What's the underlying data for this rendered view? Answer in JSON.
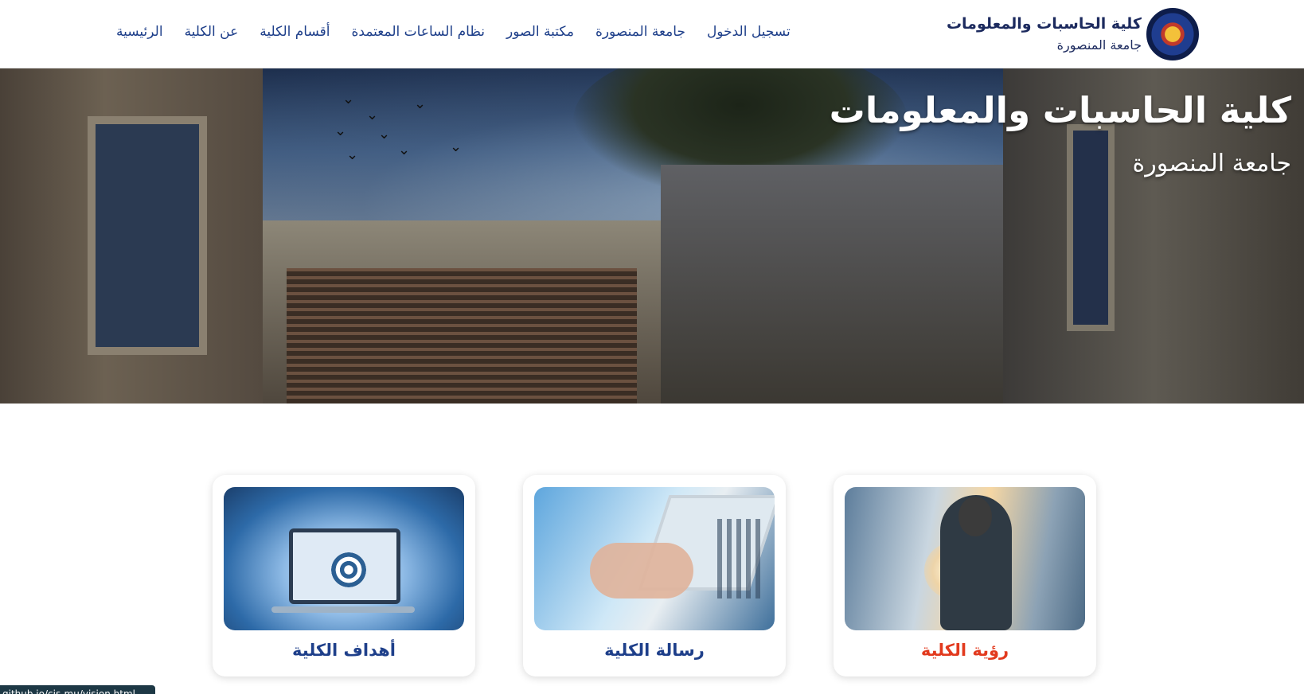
{
  "brand": {
    "title": "كلية الحاسبات والمعلومات",
    "subtitle": "جامعة المنصورة"
  },
  "nav": {
    "items": [
      {
        "label": "الرئيسية"
      },
      {
        "label": "عن الكلية"
      },
      {
        "label": "أقسام الكلية"
      },
      {
        "label": "نظام الساعات المعتمدة"
      },
      {
        "label": "مكتبة الصور"
      },
      {
        "label": "جامعة المنصورة"
      },
      {
        "label": "تسجيل الدخول"
      }
    ]
  },
  "hero": {
    "title": "كلية الحاسبات والمعلومات",
    "subtitle": "جامعة المنصورة"
  },
  "cards": [
    {
      "title": "رؤية الكلية",
      "color": "#e23a1e",
      "active": true
    },
    {
      "title": "رسالة الكلية",
      "color": "#1e3f8a",
      "active": false
    },
    {
      "title": "أهداف الكلية",
      "color": "#1e3f8a",
      "active": false
    }
  ],
  "status": {
    "url": "github.io/cis-mu/vision.html"
  },
  "colors": {
    "nav_text": "#1e3f8a",
    "accent_red": "#e23a1e",
    "brand_navy": "#1c2a5e"
  }
}
